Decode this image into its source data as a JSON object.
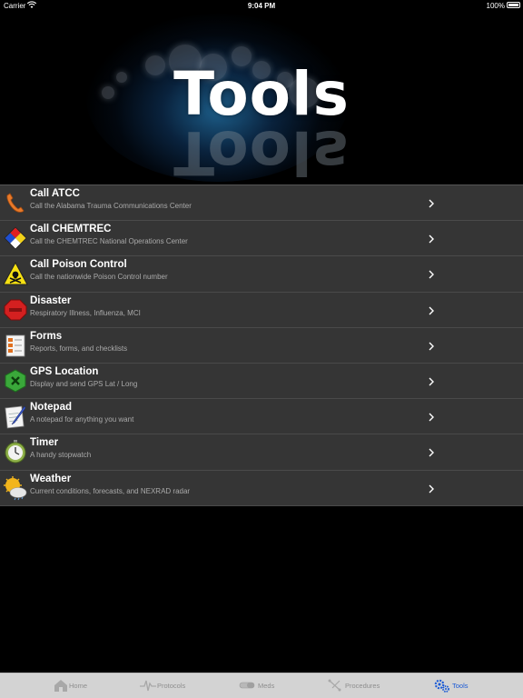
{
  "status_bar": {
    "carrier": "Carrier",
    "time": "9:04 PM",
    "battery": "100%"
  },
  "header": {
    "title": "Tools"
  },
  "tools": [
    {
      "title": "Call ATCC",
      "subtitle": "Call the Alabama Trauma Communications Center",
      "icon": "phone-icon"
    },
    {
      "title": "Call CHEMTREC",
      "subtitle": "Call the CHEMTREC National Operations Center",
      "icon": "hazmat-diamond-icon"
    },
    {
      "title": "Call Poison Control",
      "subtitle": "Call the nationwide Poison Control number",
      "icon": "poison-warning-icon"
    },
    {
      "title": "Disaster",
      "subtitle": "Respiratory Illness, Influenza, MCI",
      "icon": "disaster-icon"
    },
    {
      "title": "Forms",
      "subtitle": "Reports, forms, and checklists",
      "icon": "forms-icon"
    },
    {
      "title": "GPS Location",
      "subtitle": "Display and send GPS Lat / Long",
      "icon": "gps-icon"
    },
    {
      "title": "Notepad",
      "subtitle": "A notepad for anything you want",
      "icon": "notepad-icon"
    },
    {
      "title": "Timer",
      "subtitle": "A handy stopwatch",
      "icon": "stopwatch-icon"
    },
    {
      "title": "Weather",
      "subtitle": "Current conditions, forecasts, and NEXRAD radar",
      "icon": "weather-icon"
    }
  ],
  "tab_bar": {
    "tabs": [
      {
        "label": "Home",
        "icon": "home-icon"
      },
      {
        "label": "Protocols",
        "icon": "ekg-icon"
      },
      {
        "label": "Meds",
        "icon": "pill-icon"
      },
      {
        "label": "Procedures",
        "icon": "procedures-icon"
      },
      {
        "label": "Tools",
        "icon": "gear-icon"
      }
    ],
    "active": "Tools"
  },
  "colors": {
    "background": "#000000",
    "row_background": "#353535",
    "active_tab": "#1a5ad6",
    "inactive_tab": "#8e8e8e"
  }
}
